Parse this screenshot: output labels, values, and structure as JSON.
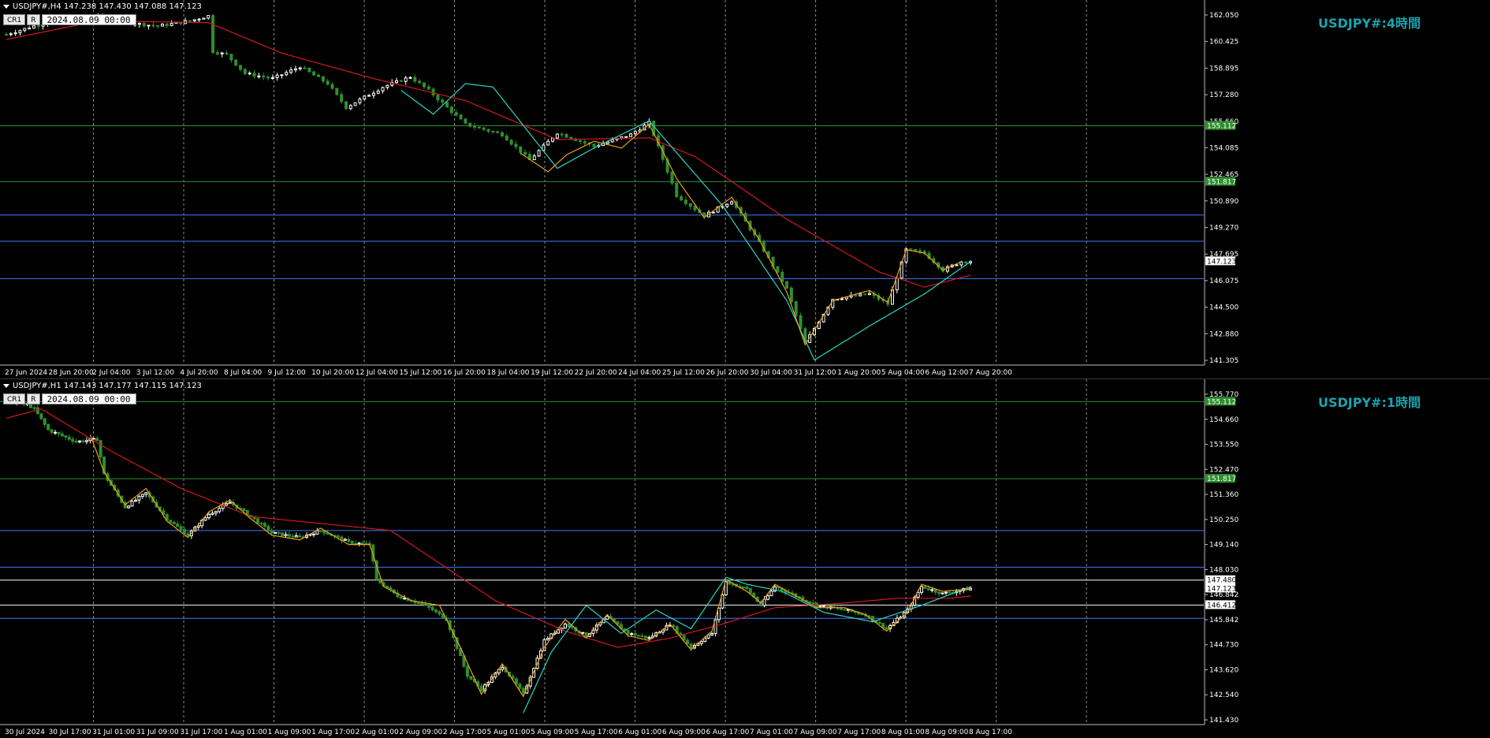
{
  "colors": {
    "background": "#000000",
    "bull": "#ffffff",
    "bear": "#2f8f2f",
    "ma_red": "#d11a1a",
    "ma_cyan": "#29d6c6",
    "zigzag": "#e6a118",
    "hline_green": "#2f8f2f",
    "hline_blue": "#3a7bff",
    "hline_white": "#ffffff",
    "grid": "#8a8a8a",
    "title": "#1aa3b0"
  },
  "charts": [
    {
      "id": "h4",
      "header": "USDJPY#,H4  147.238 147.430 147.088 147.123",
      "buttons": [
        "CR1",
        "R"
      ],
      "date_value": "2024.08.09 00:00",
      "title": "USDJPY#:4時間",
      "price_labels": [
        "162.050",
        "160.425",
        "158.895",
        "157.280",
        "155.660",
        "154.085",
        "152.465",
        "150.890",
        "149.270",
        "147.695",
        "146.075",
        "144.500",
        "142.880",
        "141.305"
      ],
      "price_range": [
        141.0,
        162.3
      ],
      "x_labels": [
        "27 Jun 2024",
        "28 Jun 20:00",
        "2 Jul 04:00",
        "3 Jul 12:00",
        "4 Jul 20:00",
        "8 Jul 04:00",
        "9 Jul 12:00",
        "10 Jul 20:00",
        "12 Jul 04:00",
        "15 Jul 12:00",
        "16 Jul 20:00",
        "18 Jul 04:00",
        "19 Jul 12:00",
        "22 Jul 20:00",
        "24 Jul 04:00",
        "25 Jul 12:00",
        "26 Jul 20:00",
        "30 Jul 04:00",
        "31 Jul 12:00",
        "1 Aug 20:00",
        "5 Aug 04:00",
        "6 Aug 12:00",
        "7 Aug 20:00"
      ],
      "hlines": [
        {
          "price": 155.112,
          "color": "green",
          "label": "155.112"
        },
        {
          "price": 151.817,
          "color": "green",
          "label": "151.817"
        },
        {
          "price": 149.85,
          "color": "blue",
          "label": ""
        },
        {
          "price": 148.3,
          "color": "blue",
          "label": ""
        },
        {
          "price": 146.1,
          "color": "blue",
          "label": ""
        }
      ],
      "current_price": "147.123",
      "price_anchors": [
        [
          0,
          160.5
        ],
        [
          6,
          161.0
        ],
        [
          12,
          161.4
        ],
        [
          20,
          161.6
        ],
        [
          26,
          161.2
        ],
        [
          33,
          161.0
        ],
        [
          40,
          161.3
        ],
        [
          44,
          161.6
        ],
        [
          45,
          159.5
        ],
        [
          48,
          159.3
        ],
        [
          52,
          158.2
        ],
        [
          58,
          157.9
        ],
        [
          64,
          158.6
        ],
        [
          70,
          157.6
        ],
        [
          74,
          156.2
        ],
        [
          82,
          157.4
        ],
        [
          88,
          158.0
        ],
        [
          92,
          157.2
        ],
        [
          100,
          155.2
        ],
        [
          108,
          154.6
        ],
        [
          114,
          153.1
        ],
        [
          120,
          154.7
        ],
        [
          128,
          153.9
        ],
        [
          136,
          154.6
        ],
        [
          140,
          155.3
        ],
        [
          146,
          151.0
        ],
        [
          152,
          149.8
        ],
        [
          158,
          150.7
        ],
        [
          164,
          148.2
        ],
        [
          170,
          145.5
        ],
        [
          174,
          142.3
        ],
        [
          180,
          144.9
        ],
        [
          188,
          145.2
        ],
        [
          192,
          144.6
        ],
        [
          196,
          147.8
        ],
        [
          200,
          147.6
        ],
        [
          204,
          146.6
        ],
        [
          208,
          147.1
        ],
        [
          210,
          147.123
        ]
      ],
      "ma_red_anchors": [
        [
          0,
          160.2
        ],
        [
          20,
          161.3
        ],
        [
          44,
          161.2
        ],
        [
          60,
          159.4
        ],
        [
          80,
          157.9
        ],
        [
          100,
          156.6
        ],
        [
          120,
          154.3
        ],
        [
          140,
          154.4
        ],
        [
          150,
          153.3
        ],
        [
          170,
          149.6
        ],
        [
          190,
          146.5
        ],
        [
          200,
          145.6
        ],
        [
          210,
          146.3
        ]
      ],
      "ma_cyan_anchors": [
        [
          86,
          157.2
        ],
        [
          93,
          155.8
        ],
        [
          100,
          157.6
        ],
        [
          106,
          157.4
        ],
        [
          120,
          152.6
        ],
        [
          128,
          153.8
        ],
        [
          140,
          155.4
        ],
        [
          156,
          150.4
        ],
        [
          170,
          144.8
        ],
        [
          176,
          141.3
        ],
        [
          188,
          143.3
        ],
        [
          200,
          145.2
        ],
        [
          210,
          147.1
        ]
      ],
      "zigzag_anchors": [
        [
          112,
          153.5
        ],
        [
          118,
          152.4
        ],
        [
          122,
          153.4
        ],
        [
          128,
          154.2
        ],
        [
          134,
          153.8
        ],
        [
          140,
          155.2
        ],
        [
          146,
          152.0
        ],
        [
          152,
          149.7
        ],
        [
          158,
          150.9
        ],
        [
          164,
          148.4
        ],
        [
          170,
          145.3
        ],
        [
          174,
          142.2
        ],
        [
          180,
          144.8
        ],
        [
          188,
          145.4
        ],
        [
          192,
          144.7
        ],
        [
          196,
          147.8
        ],
        [
          200,
          147.6
        ],
        [
          204,
          146.6
        ],
        [
          208,
          147.1
        ]
      ]
    },
    {
      "id": "h1",
      "header": "USDJPY#,H1  147.143 147.177 147.115 147.123",
      "buttons": [
        "CR1",
        "R"
      ],
      "date_value": "2024.08.09 00:00",
      "title": "USDJPY#:1時間",
      "price_labels": [
        "155.770",
        "154.660",
        "153.550",
        "152.470",
        "151.360",
        "150.250",
        "149.140",
        "148.030",
        "146.842",
        "145.842",
        "144.730",
        "143.620",
        "142.540",
        "141.430"
      ],
      "price_range": [
        141.3,
        155.9
      ],
      "x_labels": [
        "30 Jul 2024",
        "30 Jul 17:00",
        "31 Jul 01:00",
        "31 Jul 09:00",
        "31 Jul 17:00",
        "1 Aug 01:00",
        "1 Aug 09:00",
        "1 Aug 17:00",
        "2 Aug 01:00",
        "2 Aug 09:00",
        "2 Aug 17:00",
        "5 Aug 01:00",
        "5 Aug 09:00",
        "5 Aug 17:00",
        "6 Aug 01:00",
        "6 Aug 09:00",
        "6 Aug 17:00",
        "7 Aug 01:00",
        "7 Aug 09:00",
        "7 Aug 17:00",
        "8 Aug 01:00",
        "8 Aug 09:00",
        "8 Aug 17:00"
      ],
      "hlines": [
        {
          "price": 155.112,
          "color": "green",
          "label": "155.112"
        },
        {
          "price": 151.817,
          "color": "green",
          "label": "151.817"
        },
        {
          "price": 149.6,
          "color": "blue",
          "label": ""
        },
        {
          "price": 148.03,
          "color": "blue",
          "label": ""
        },
        {
          "price": 147.48,
          "color": "white",
          "label": "147.480"
        },
        {
          "price": 146.412,
          "color": "white",
          "label": "146.412"
        },
        {
          "price": 145.842,
          "color": "blue",
          "label": ""
        }
      ],
      "current_price": "147.123",
      "price_anchors": [
        [
          0,
          155.1
        ],
        [
          6,
          155.0
        ],
        [
          8,
          154.8
        ],
        [
          12,
          153.9
        ],
        [
          20,
          153.4
        ],
        [
          26,
          153.5
        ],
        [
          28,
          152.0
        ],
        [
          34,
          150.6
        ],
        [
          40,
          151.2
        ],
        [
          46,
          150.1
        ],
        [
          52,
          149.4
        ],
        [
          58,
          150.3
        ],
        [
          64,
          150.8
        ],
        [
          70,
          150.2
        ],
        [
          76,
          149.5
        ],
        [
          84,
          149.3
        ],
        [
          90,
          149.6
        ],
        [
          98,
          149.1
        ],
        [
          104,
          149.0
        ],
        [
          106,
          147.5
        ],
        [
          112,
          146.8
        ],
        [
          120,
          146.4
        ],
        [
          126,
          145.8
        ],
        [
          132,
          143.4
        ],
        [
          136,
          142.8
        ],
        [
          142,
          143.8
        ],
        [
          148,
          142.6
        ],
        [
          154,
          144.9
        ],
        [
          160,
          145.6
        ],
        [
          166,
          145.1
        ],
        [
          172,
          145.9
        ],
        [
          178,
          145.2
        ],
        [
          184,
          145.0
        ],
        [
          190,
          145.6
        ],
        [
          196,
          144.6
        ],
        [
          202,
          145.2
        ],
        [
          206,
          147.4
        ],
        [
          212,
          147.1
        ],
        [
          216,
          146.4
        ],
        [
          220,
          147.2
        ],
        [
          226,
          146.8
        ],
        [
          232,
          146.4
        ],
        [
          240,
          146.2
        ],
        [
          246,
          146.0
        ],
        [
          252,
          145.4
        ],
        [
          258,
          146.2
        ],
        [
          262,
          147.2
        ],
        [
          268,
          146.9
        ],
        [
          276,
          147.123
        ]
      ],
      "ma_red_anchors": [
        [
          0,
          154.4
        ],
        [
          10,
          154.8
        ],
        [
          30,
          153.0
        ],
        [
          50,
          151.4
        ],
        [
          70,
          150.2
        ],
        [
          90,
          149.9
        ],
        [
          110,
          149.6
        ],
        [
          120,
          148.6
        ],
        [
          140,
          146.6
        ],
        [
          160,
          145.3
        ],
        [
          175,
          144.6
        ],
        [
          190,
          145.0
        ],
        [
          205,
          145.6
        ],
        [
          220,
          146.3
        ],
        [
          240,
          146.5
        ],
        [
          255,
          146.7
        ],
        [
          270,
          146.7
        ],
        [
          276,
          146.8
        ]
      ],
      "ma_cyan_anchors": [
        [
          148,
          141.8
        ],
        [
          156,
          144.4
        ],
        [
          166,
          146.4
        ],
        [
          176,
          145.2
        ],
        [
          186,
          146.2
        ],
        [
          196,
          145.4
        ],
        [
          206,
          147.6
        ],
        [
          212,
          147.3
        ],
        [
          222,
          147.0
        ],
        [
          234,
          146.1
        ],
        [
          248,
          145.7
        ],
        [
          262,
          146.4
        ],
        [
          276,
          147.2
        ]
      ],
      "zigzag_anchors": [
        [
          24,
          153.7
        ],
        [
          28,
          152.1
        ],
        [
          34,
          150.7
        ],
        [
          40,
          151.4
        ],
        [
          46,
          150.0
        ],
        [
          52,
          149.3
        ],
        [
          58,
          150.4
        ],
        [
          64,
          150.9
        ],
        [
          70,
          150.1
        ],
        [
          76,
          149.4
        ],
        [
          84,
          149.2
        ],
        [
          90,
          149.7
        ],
        [
          98,
          149.0
        ],
        [
          104,
          149.0
        ],
        [
          108,
          147.2
        ],
        [
          116,
          146.6
        ],
        [
          124,
          146.4
        ],
        [
          130,
          144.6
        ],
        [
          136,
          142.6
        ],
        [
          142,
          143.9
        ],
        [
          148,
          142.5
        ],
        [
          154,
          144.6
        ],
        [
          160,
          145.8
        ],
        [
          166,
          145.0
        ],
        [
          172,
          146.0
        ],
        [
          178,
          145.1
        ],
        [
          184,
          144.9
        ],
        [
          190,
          145.6
        ],
        [
          196,
          144.5
        ],
        [
          202,
          145.3
        ],
        [
          206,
          147.5
        ],
        [
          212,
          147.0
        ],
        [
          216,
          146.5
        ],
        [
          220,
          147.3
        ],
        [
          226,
          146.8
        ],
        [
          232,
          146.3
        ],
        [
          240,
          146.3
        ],
        [
          246,
          146.0
        ],
        [
          252,
          145.3
        ],
        [
          258,
          146.1
        ],
        [
          262,
          147.3
        ],
        [
          268,
          147.0
        ],
        [
          276,
          147.1
        ]
      ]
    }
  ]
}
